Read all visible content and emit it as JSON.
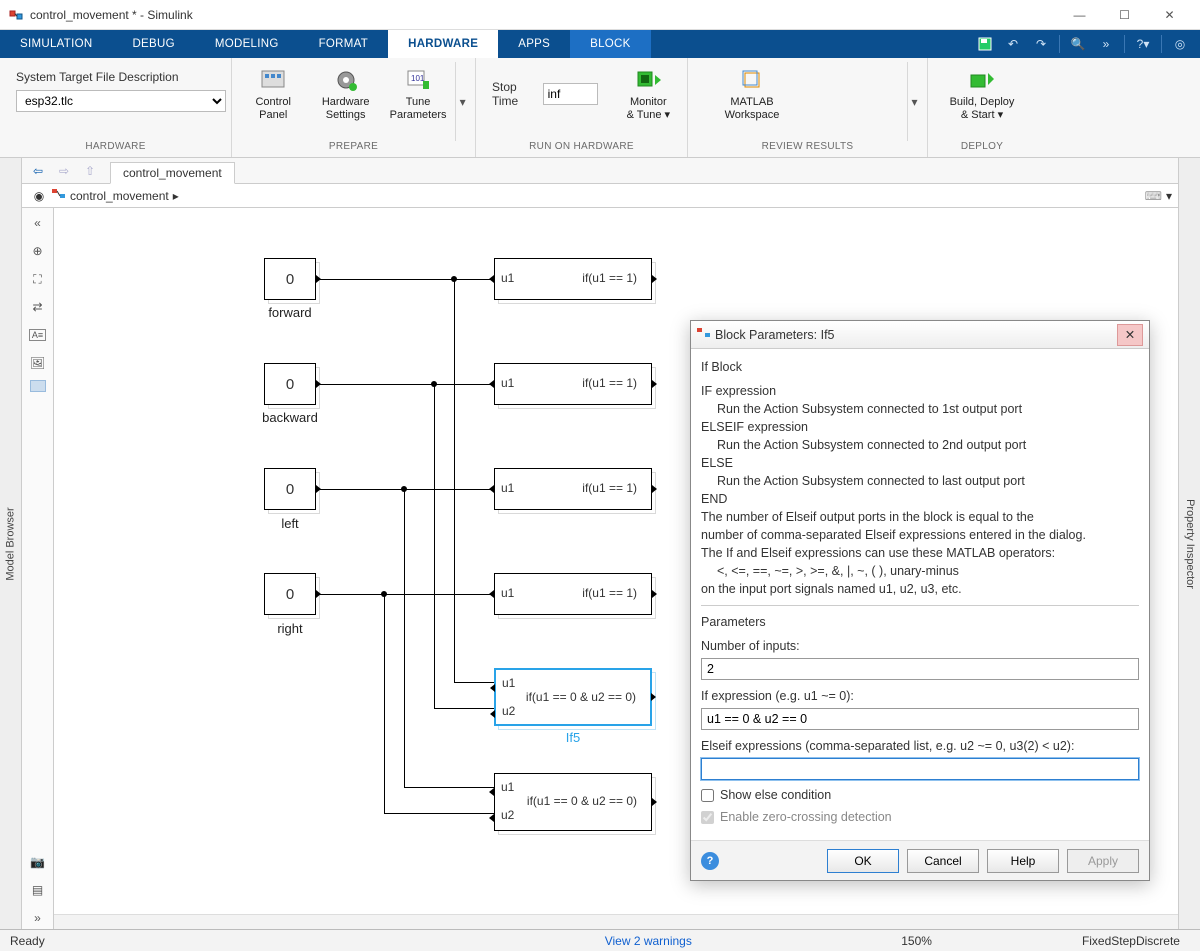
{
  "window": {
    "title": "control_movement * - Simulink"
  },
  "tabs": [
    "SIMULATION",
    "DEBUG",
    "MODELING",
    "FORMAT",
    "HARDWARE",
    "APPS",
    "BLOCK"
  ],
  "ribbon": {
    "hw_label": "System Target File Description",
    "hw_value": "esp32.tlc",
    "groups": {
      "hardware": "HARDWARE",
      "prepare": "PREPARE",
      "run": "RUN ON HARDWARE",
      "review": "REVIEW RESULTS",
      "deploy": "DEPLOY"
    },
    "buttons": {
      "control_panel": "Control\nPanel",
      "hw_settings": "Hardware\nSettings",
      "tune": "Tune\nParameters",
      "stop_time_label": "Stop Time",
      "stop_time_value": "inf",
      "monitor": "Monitor\n& Tune",
      "matlab_ws": "MATLAB\nWorkspace",
      "deploy": "Build, Deploy\n& Start"
    }
  },
  "nav": {
    "doc_tab": "control_movement",
    "breadcrumb": "control_movement"
  },
  "blocks": {
    "const_val": "0",
    "labels": {
      "forward": "forward",
      "backward": "backward",
      "left": "left",
      "right": "right",
      "if5": "If5"
    },
    "if1": {
      "u": "u1",
      "cond": "if(u1 == 1)"
    },
    "if2": {
      "u": "u1",
      "cond": "if(u1 == 1)"
    },
    "if3": {
      "u": "u1",
      "cond": "if(u1 == 1)"
    },
    "if4": {
      "u": "u1",
      "cond": "if(u1 == 1)"
    },
    "if5": {
      "u1": "u1",
      "u2": "u2",
      "cond": "if(u1 == 0 & u2 == 0)"
    },
    "if6": {
      "u1": "u1",
      "u2": "u2",
      "cond": "if(u1 == 0 & u2 == 0)"
    }
  },
  "dialog": {
    "title": "Block Parameters: If5",
    "heading": "If Block",
    "desc1": "IF expression",
    "desc1b": "Run the Action Subsystem connected to 1st output port",
    "desc2": "ELSEIF expression",
    "desc2b": "Run the Action Subsystem connected to 2nd output port",
    "desc3": "ELSE",
    "desc3b": "Run the Action Subsystem connected to last output port",
    "desc4": "END",
    "desc5": "The number of Elseif output ports in the block is equal to the",
    "desc5b": "number of comma-separated Elseif expressions entered in the dialog.",
    "desc6": "The If and Elseif expressions can use these MATLAB operators:",
    "desc6b": "<, <=, ==, ~=, >, >=, &, |, ~, (  ), unary-minus",
    "desc7": "on the input port signals named u1, u2, u3, etc.",
    "params": "Parameters",
    "num_label": "Number of inputs:",
    "num_value": "2",
    "ifexpr_label": "If expression (e.g. u1 ~= 0):",
    "ifexpr_value": "u1 == 0 & u2 == 0",
    "elseif_label": "Elseif expressions (comma-separated list, e.g. u2 ~= 0, u3(2) < u2):",
    "elseif_value": "",
    "chk_else": "Show else condition",
    "chk_zero": "Enable zero-crossing detection",
    "ok": "OK",
    "cancel": "Cancel",
    "help": "Help",
    "apply": "Apply"
  },
  "status": {
    "ready": "Ready",
    "warn": "View 2 warnings",
    "zoom": "150%",
    "solver": "FixedStepDiscrete"
  },
  "side": {
    "left": "Model Browser",
    "right": "Property Inspector"
  }
}
